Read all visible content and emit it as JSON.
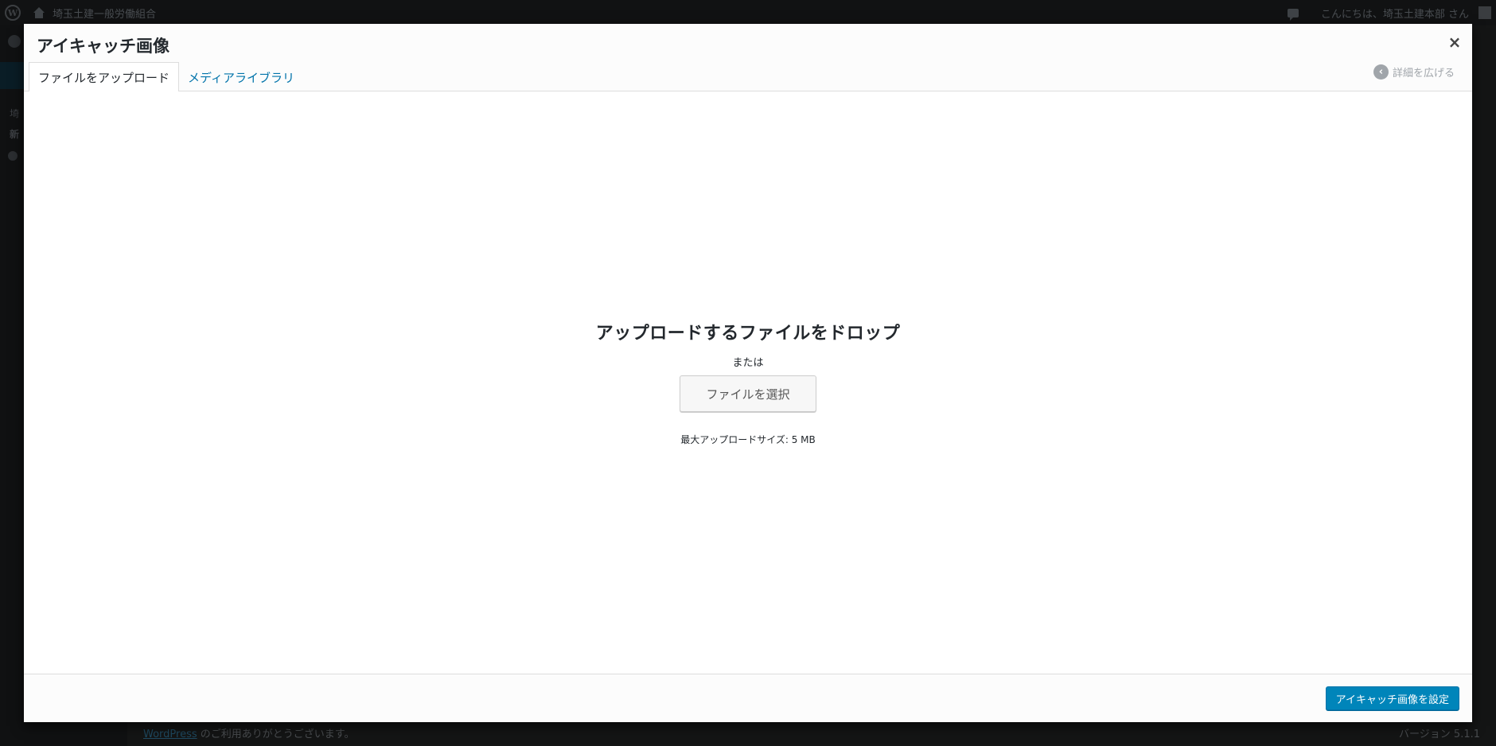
{
  "adminbar": {
    "site_name": "埼玉土建一般労働組合",
    "greeting": "こんにちは、埼玉土建本部 さん"
  },
  "sidebar": {
    "ghost_1": "埼",
    "ghost_2": "新"
  },
  "footer": {
    "wordpress_link": "WordPress",
    "thanks_rest": " のご利用ありがとうございます。",
    "version": "バージョン 5.1.1"
  },
  "modal": {
    "title": "アイキャッチ画像",
    "close_label": "×",
    "tabs": [
      {
        "label": "ファイルをアップロード",
        "active": true
      },
      {
        "label": "メディアライブラリ",
        "active": false
      }
    ],
    "expand_label": "詳細を広げる",
    "drop_message": "アップロードするファイルをドロップ",
    "or_text": "または",
    "select_files_button": "ファイルを選択",
    "max_upload": "最大アップロードサイズ: 5 MB",
    "primary_button": "アイキャッチ画像を設定"
  },
  "colors": {
    "accent": "#0085ba",
    "link": "#0073aa",
    "overlay": "#0b0c0d"
  },
  "icons": {
    "close": "close-icon",
    "expand": "chevron-left-icon"
  }
}
